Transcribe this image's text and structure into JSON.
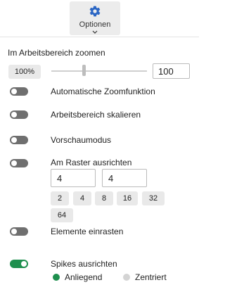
{
  "colors": {
    "accent": "#1e8f4e",
    "brand_blue": "#2b66c4",
    "toggle_off": "#6f6f6f"
  },
  "options_button": {
    "label": "Optionen",
    "icon": "gear-icon"
  },
  "zoom": {
    "title": "Im Arbeitsbereich zoomen",
    "percent_chip": "100%",
    "slider_level": 0.34,
    "value": "100"
  },
  "toggles": [
    {
      "label": "Automatische Zoomfunktion",
      "on": false
    },
    {
      "label": "Arbeitsbereich skalieren",
      "on": false
    },
    {
      "label": "Vorschaumodus",
      "on": false
    },
    {
      "label": "Am Raster ausrichten",
      "on": false
    },
    {
      "label": "Elemente einrasten",
      "on": false
    },
    {
      "label": "Spikes ausrichten",
      "on": true
    }
  ],
  "grid": {
    "input_x": "4",
    "input_y": "4",
    "presets": [
      "2",
      "4",
      "8",
      "16",
      "32",
      "64"
    ]
  },
  "spikes": {
    "options": [
      {
        "label": "Anliegend",
        "selected": true
      },
      {
        "label": "Zentriert",
        "selected": false
      }
    ]
  }
}
